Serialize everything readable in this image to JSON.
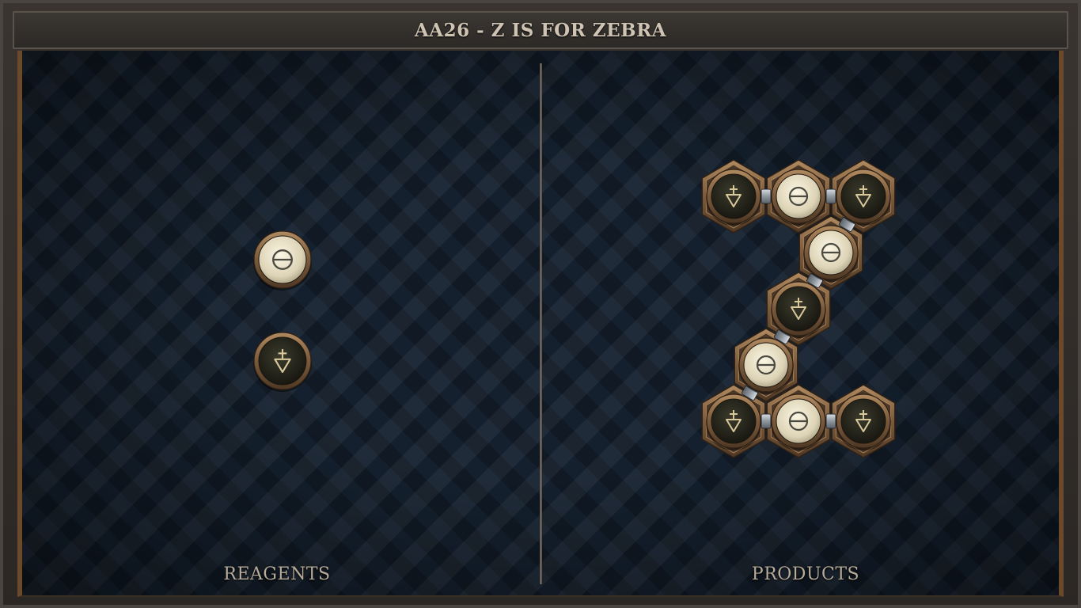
{
  "header": {
    "title": "AA26 - Z IS FOR ZEBRA"
  },
  "panels": {
    "reagents_label": "REAGENTS",
    "products_label": "PRODUCTS"
  },
  "reagents": [
    {
      "element": "salt",
      "icon": "salt-icon"
    },
    {
      "element": "earth",
      "icon": "earth-icon"
    }
  ],
  "product": {
    "atoms": [
      {
        "element": "earth",
        "row": 0,
        "col": 0
      },
      {
        "element": "salt",
        "row": 0,
        "col": 1
      },
      {
        "element": "earth",
        "row": 0,
        "col": 2
      },
      {
        "element": "salt",
        "row": 1,
        "col": 1.5
      },
      {
        "element": "earth",
        "row": 2,
        "col": 1
      },
      {
        "element": "salt",
        "row": 3,
        "col": 0.5
      },
      {
        "element": "earth",
        "row": 4,
        "col": 0
      },
      {
        "element": "salt",
        "row": 4,
        "col": 1
      },
      {
        "element": "earth",
        "row": 4,
        "col": 2
      }
    ],
    "bonds": [
      [
        0,
        1
      ],
      [
        1,
        2
      ],
      [
        2,
        3
      ],
      [
        3,
        4
      ],
      [
        4,
        5
      ],
      [
        5,
        6
      ],
      [
        6,
        7
      ],
      [
        7,
        8
      ]
    ]
  },
  "colors": {
    "salt_fill": "#e7dfc6",
    "earth_fill": "#26261c",
    "bronze": "#8a6a48",
    "symbol_light": "#d8c89a",
    "symbol_dark": "#4a4a40"
  }
}
